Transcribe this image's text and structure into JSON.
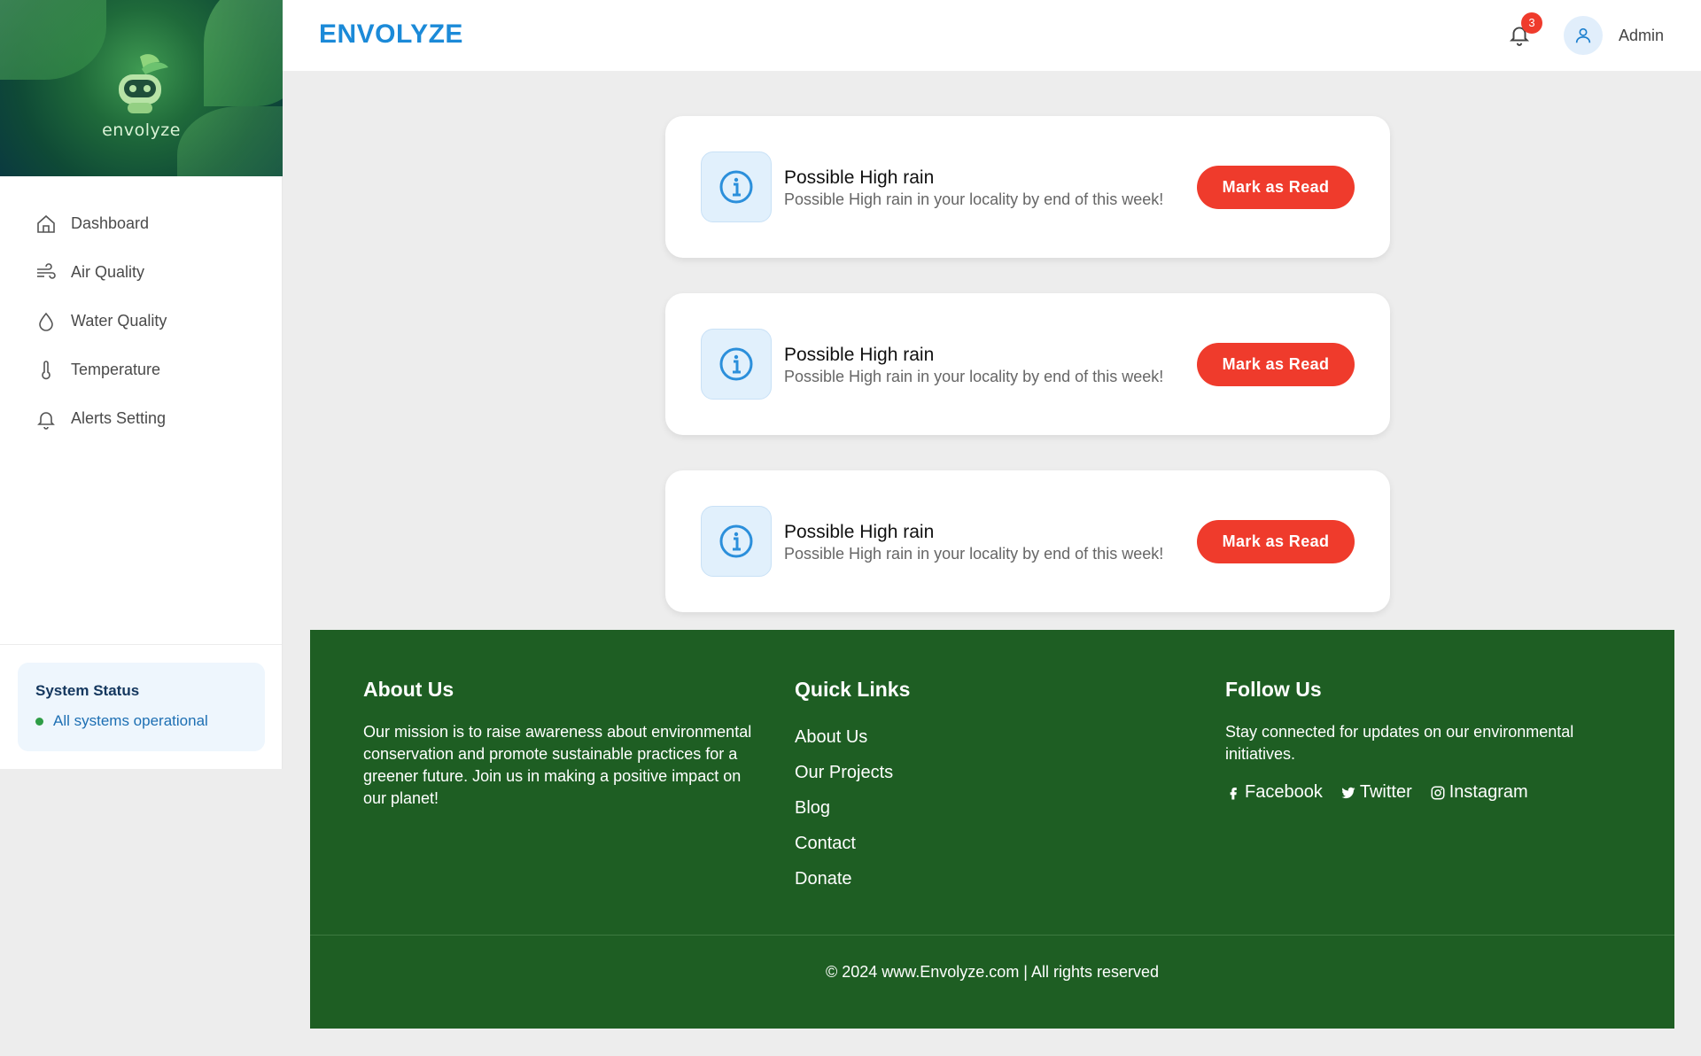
{
  "app": {
    "brand": "ENVOLYZE",
    "logo_text": "envolyze"
  },
  "sidebar": {
    "items": [
      {
        "label": "Dashboard",
        "icon": "home-icon"
      },
      {
        "label": "Air Quality",
        "icon": "wind-icon"
      },
      {
        "label": "Water Quality",
        "icon": "droplet-icon"
      },
      {
        "label": "Temperature",
        "icon": "thermometer-icon"
      },
      {
        "label": "Alerts Setting",
        "icon": "bell-icon"
      }
    ],
    "status": {
      "title": "System Status",
      "text": "All systems operational",
      "color": "#2e9d46"
    }
  },
  "header": {
    "notification_count": "3",
    "user_name": "Admin"
  },
  "alerts": [
    {
      "title": "Possible High rain",
      "message": "Possible High rain in your locality by end of this week!",
      "button": "Mark as Read"
    },
    {
      "title": "Possible High rain",
      "message": "Possible High rain in your locality by end of this week!",
      "button": "Mark as Read"
    },
    {
      "title": "Possible High rain",
      "message": "Possible High rain in your locality by end of this week!",
      "button": "Mark as Read"
    }
  ],
  "footer": {
    "about": {
      "heading": "About Us",
      "text": "Our mission is to raise awareness about environmental conservation and promote sustainable practices for a greener future. Join us in making a positive impact on our planet!"
    },
    "quick_links": {
      "heading": "Quick Links",
      "links": [
        "About Us",
        "Our Projects",
        "Blog",
        "Contact",
        "Donate"
      ]
    },
    "follow": {
      "heading": "Follow Us",
      "text": "Stay connected for updates on our environmental initiatives.",
      "social": [
        "Facebook",
        "Twitter",
        "Instagram"
      ]
    },
    "copyright": "© 2024 www.Envolyze.com | All rights reserved"
  },
  "colors": {
    "brand": "#1b8ad8",
    "danger": "#ef3b2c",
    "footer_bg": "#1e5e23"
  }
}
